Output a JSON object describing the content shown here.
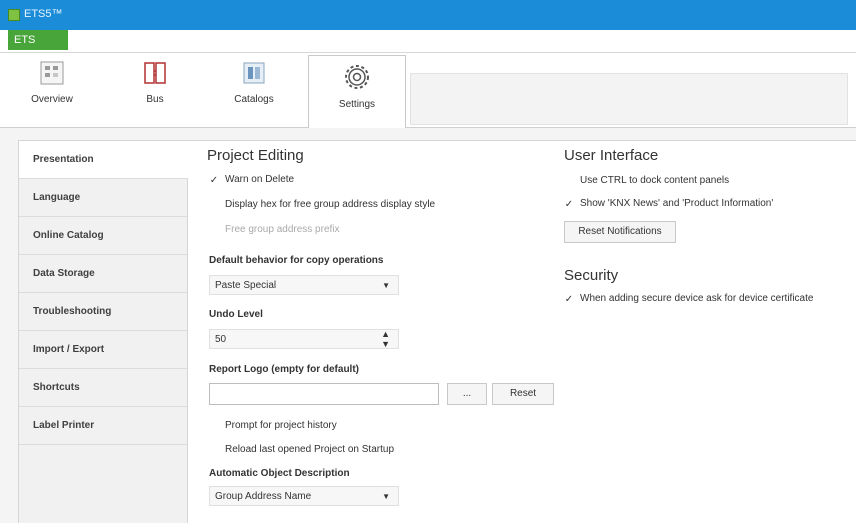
{
  "window": {
    "title": "ETS5™"
  },
  "menu": {
    "ets_button": "ETS"
  },
  "ribbon": {
    "tabs": [
      {
        "label": "Overview",
        "icon": "overview-icon"
      },
      {
        "label": "Bus",
        "icon": "bus-icon"
      },
      {
        "label": "Catalogs",
        "icon": "catalogs-icon"
      },
      {
        "label": "Settings",
        "icon": "settings-gear-icon",
        "active": true
      }
    ]
  },
  "sidebar": {
    "items": [
      {
        "label": "Presentation",
        "selected": true
      },
      {
        "label": "Language"
      },
      {
        "label": "Online Catalog"
      },
      {
        "label": "Data Storage"
      },
      {
        "label": "Troubleshooting"
      },
      {
        "label": "Import / Export"
      },
      {
        "label": "Shortcuts"
      },
      {
        "label": "Label Printer"
      }
    ]
  },
  "project_editing": {
    "heading": "Project Editing",
    "warn_on_delete": {
      "label": "Warn on Delete",
      "checked": true
    },
    "display_hex": {
      "label": "Display hex for free group address display style",
      "checked": false
    },
    "free_group_prefix": {
      "label": "Free group address prefix",
      "checked": false,
      "disabled": true
    },
    "copy_behavior_label": "Default behavior for copy operations",
    "copy_behavior_value": "Paste Special",
    "undo_label": "Undo Level",
    "undo_value": "50",
    "report_logo_label": "Report Logo (empty for default)",
    "report_logo_value": "",
    "browse_label": "...",
    "reset_label": "Reset",
    "prompt_history": {
      "label": "Prompt for project history",
      "checked": false
    },
    "reload_last": {
      "label": "Reload last opened Project on Startup",
      "checked": false
    },
    "auto_desc_label": "Automatic Object Description",
    "auto_desc_value": "Group Address Name"
  },
  "user_interface": {
    "heading": "User Interface",
    "ctrl_dock": {
      "label": "Use CTRL to dock content panels",
      "checked": false
    },
    "show_news": {
      "label": "Show 'KNX News' and 'Product Information'",
      "checked": true
    },
    "reset_notifications": "Reset Notifications"
  },
  "security": {
    "heading": "Security",
    "ask_certificate": {
      "label": "When adding secure device ask for device certificate",
      "checked": true
    }
  },
  "check_glyph": "✓"
}
